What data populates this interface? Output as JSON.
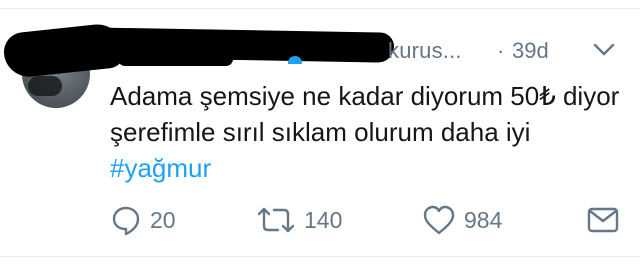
{
  "tweet": {
    "handle_fragment": "kurus...",
    "separator": "·",
    "timestamp": "39d",
    "text": "Adama şemsiye ne kadar diyorum 50₺ diyor şerefimle sırıl sıklam olurum daha iyi ",
    "hashtag": "#yağmur"
  },
  "actions": {
    "reply_count": "20",
    "retweet_count": "140",
    "like_count": "984"
  },
  "colors": {
    "accent": "#1da1f2",
    "text": "#14171a",
    "muted": "#657786"
  },
  "icons": [
    "chevron-down-icon",
    "reply-icon",
    "retweet-icon",
    "like-icon",
    "message-icon"
  ]
}
